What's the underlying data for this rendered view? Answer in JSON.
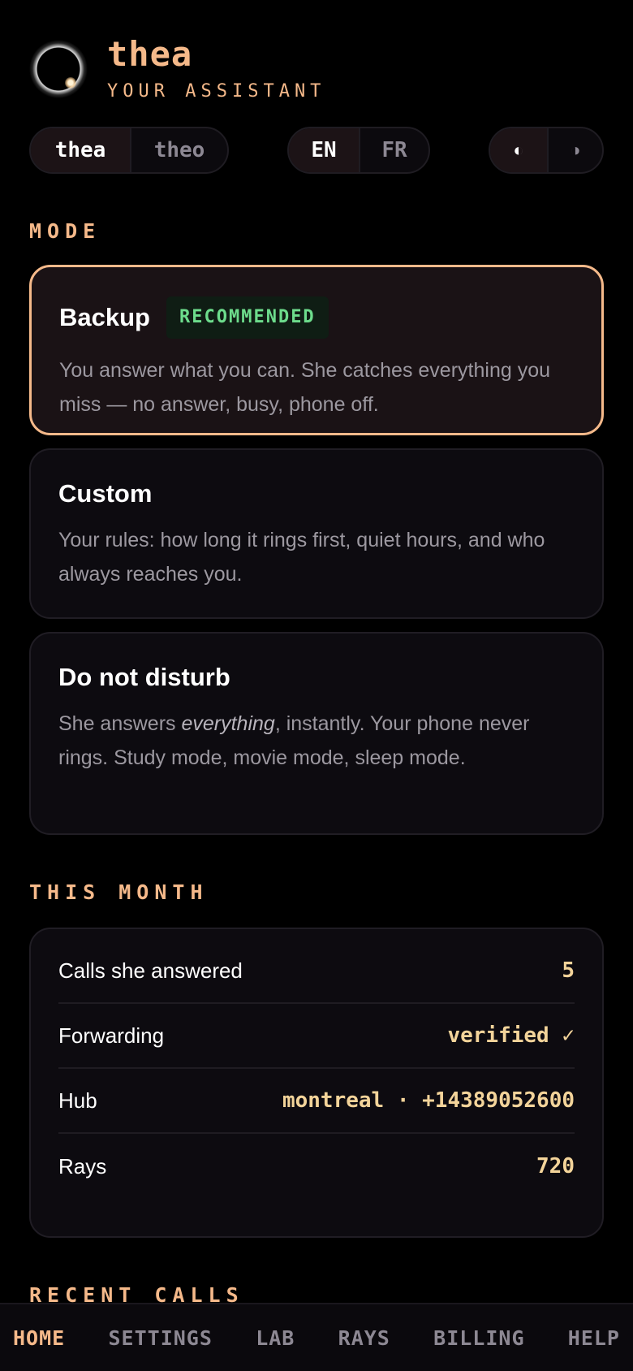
{
  "header": {
    "brand_name": "thea",
    "brand_subtitle": "YOUR ASSISTANT"
  },
  "assistant_toggle": {
    "options": [
      "thea",
      "theo"
    ],
    "selected": "thea"
  },
  "language_toggle": {
    "options": [
      "EN",
      "FR"
    ],
    "selected": "EN"
  },
  "theme_toggle": {
    "options": [
      "◐",
      "◑"
    ],
    "selected": "◐"
  },
  "mode": {
    "section_label": "MODE",
    "cards": [
      {
        "title": "Backup",
        "badge": "RECOMMENDED",
        "description": "You answer what you can. She catches everything you miss — no answer, busy, phone off.",
        "selected": true
      },
      {
        "title": "Custom",
        "description": "Your rules: how long it rings first, quiet hours, and who always reaches you.",
        "selected": false
      },
      {
        "title": "Do not disturb",
        "description_before": "She answers ",
        "description_em": "everything",
        "description_after": ", instantly. Your phone never rings. Study mode, movie mode, sleep mode.",
        "selected": false
      }
    ]
  },
  "this_month": {
    "section_label": "THIS MONTH",
    "rows": [
      {
        "label": "Calls she answered",
        "value": "5"
      },
      {
        "label": "Forwarding",
        "value": "verified ✓"
      },
      {
        "label": "Hub",
        "value": "montreal · +14389052600"
      },
      {
        "label": "Rays",
        "value": "720"
      }
    ]
  },
  "recent_calls": {
    "section_label": "RECENT CALLS"
  },
  "nav": {
    "items": [
      "HOME",
      "SETTINGS",
      "LAB",
      "RAYS",
      "BILLING",
      "HELP"
    ],
    "active": "HOME"
  },
  "colors": {
    "accent": "#f5b98a",
    "badge_green": "#6ddc8c",
    "value_gold": "#f3d49a",
    "background": "#000000",
    "card_bg": "#0d0b10"
  }
}
